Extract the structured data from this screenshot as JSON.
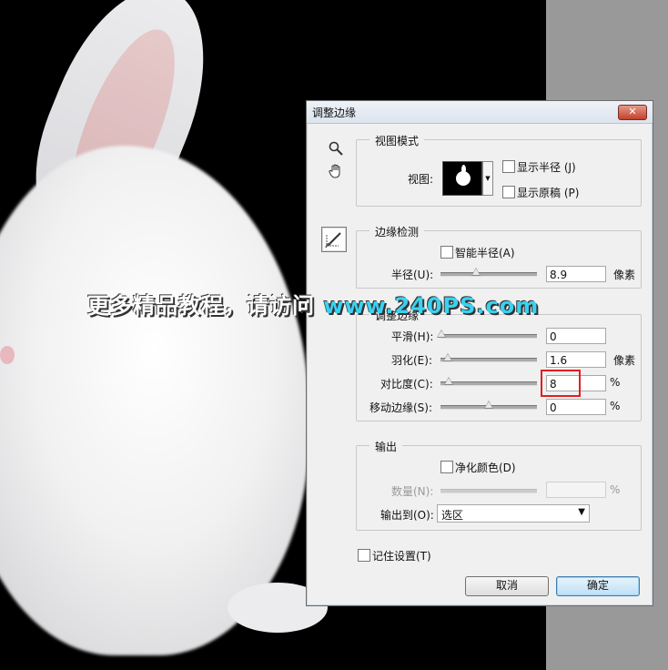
{
  "watermark": {
    "text": "更多精品教程，请访问 ",
    "url": "www.240PS.com"
  },
  "dialog": {
    "title": "调整边缘",
    "close_label": "✕",
    "view_mode": {
      "group_title": "视图模式",
      "view_label": "视图:",
      "show_radius": {
        "label": "显示半径 (J)",
        "checked": false
      },
      "show_original": {
        "label": "显示原稿 (P)",
        "checked": false
      }
    },
    "edge_detection": {
      "group_title": "边缘检测",
      "smart_radius": {
        "label": "智能半径(A)",
        "checked": false
      },
      "radius": {
        "label": "半径(U):",
        "value": "8.9",
        "unit": "像素",
        "slider_fraction": 0.4
      }
    },
    "adjust_edge": {
      "group_title": "调整边缘",
      "smooth": {
        "label": "平滑(H):",
        "value": "0",
        "unit": "",
        "slider_fraction": 0.0
      },
      "feather": {
        "label": "羽化(E):",
        "value": "1.6",
        "unit": "像素",
        "slider_fraction": 0.06
      },
      "contrast": {
        "label": "对比度(C):",
        "value": "8",
        "unit": "%",
        "slider_fraction": 0.08
      },
      "shift_edge": {
        "label": "移动边缘(S):",
        "value": "0",
        "unit": "%",
        "slider_fraction": 0.5
      }
    },
    "output": {
      "group_title": "输出",
      "decontaminate": {
        "label": "净化颜色(D)",
        "checked": false
      },
      "amount": {
        "label": "数量(N):",
        "value": "",
        "unit": "%"
      },
      "output_to": {
        "label": "输出到(O):",
        "selected": "选区"
      }
    },
    "remember": {
      "label": "记住设置(T)",
      "checked": false
    },
    "cancel_label": "取消",
    "ok_label": "确定"
  }
}
